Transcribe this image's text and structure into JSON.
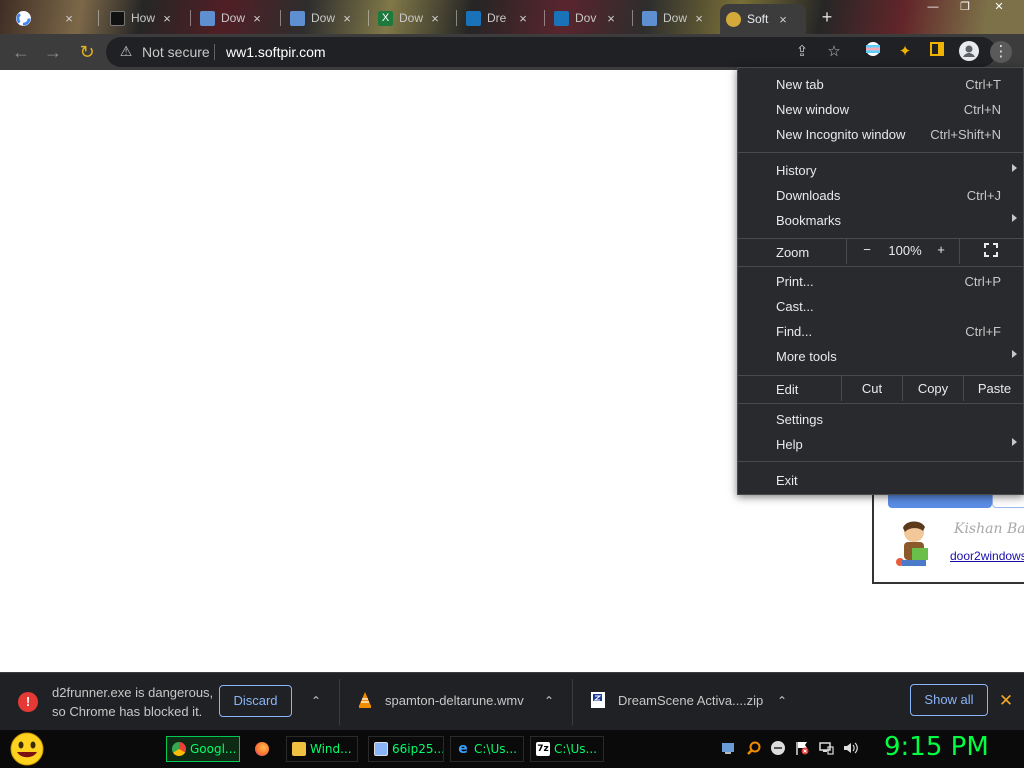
{
  "tabs": [
    {
      "title": "",
      "icon": "google-icon"
    },
    {
      "title": "How",
      "icon": "dark-site-icon"
    },
    {
      "title": "Dow",
      "icon": "download-site-icon"
    },
    {
      "title": "Dow",
      "icon": "download-site-icon"
    },
    {
      "title": "Dow",
      "icon": "excel-site-icon"
    },
    {
      "title": "Dre",
      "icon": "dreamscene-site-icon"
    },
    {
      "title": "Dov",
      "icon": "dreamscene-site-icon"
    },
    {
      "title": "Dow",
      "icon": "download-site-icon"
    },
    {
      "title": "Soft",
      "icon": "softpir-icon",
      "active": true
    }
  ],
  "address_bar": {
    "security_label": "Not secure",
    "url": "ww1.softpir.com"
  },
  "menu": {
    "items_top": [
      {
        "label": "New tab",
        "shortcut": "Ctrl+T"
      },
      {
        "label": "New window",
        "shortcut": "Ctrl+N"
      },
      {
        "label": "New Incognito window",
        "shortcut": "Ctrl+Shift+N"
      }
    ],
    "items_mid": [
      {
        "label": "History",
        "shortcut": "",
        "submenu": true
      },
      {
        "label": "Downloads",
        "shortcut": "Ctrl+J"
      },
      {
        "label": "Bookmarks",
        "shortcut": "",
        "submenu": true
      }
    ],
    "zoom": {
      "label": "Zoom",
      "minus": "−",
      "value": "100%",
      "plus": "+"
    },
    "items_tools": [
      {
        "label": "Print...",
        "shortcut": "Ctrl+P"
      },
      {
        "label": "Cast...",
        "shortcut": ""
      },
      {
        "label": "Find...",
        "shortcut": "Ctrl+F"
      },
      {
        "label": "More tools",
        "shortcut": "",
        "submenu": true
      }
    ],
    "edit": {
      "label": "Edit",
      "cut": "Cut",
      "copy": "Copy",
      "paste": "Paste"
    },
    "items_settings": [
      {
        "label": "Settings",
        "shortcut": ""
      },
      {
        "label": "Help",
        "shortcut": "",
        "submenu": true
      }
    ],
    "exit": "Exit"
  },
  "ad": {
    "name": "Kishan Bag",
    "link": "door2windows"
  },
  "download_shelf": {
    "blocked_line1": "d2frunner.exe is dangerous,",
    "blocked_line2": "so Chrome has blocked it.",
    "discard": "Discard",
    "file2": "spamton-deltarune.wmv",
    "file3": "DreamScene Activa....zip",
    "show_all": "Show all"
  },
  "taskbar": {
    "buttons": [
      {
        "label": "Googl...",
        "icon": "chrome-icon",
        "active": true
      },
      {
        "label": "",
        "icon": "firefox-icon"
      },
      {
        "label": "Wind...",
        "icon": "folder-icon"
      },
      {
        "label": "66ip25...",
        "icon": "image-viewer-icon"
      },
      {
        "label": "C:\\Us...",
        "icon": "ie-icon"
      },
      {
        "label": "C:\\Us...",
        "icon": "7zip-icon"
      }
    ],
    "clock": "9:15 PM"
  },
  "colors": {
    "toolbar": "#3c3c3c",
    "menu_bg": "#292a2d",
    "shelf_bg": "#202124",
    "link_blue": "#8ab4f8",
    "clock_green": "#00ff40"
  }
}
